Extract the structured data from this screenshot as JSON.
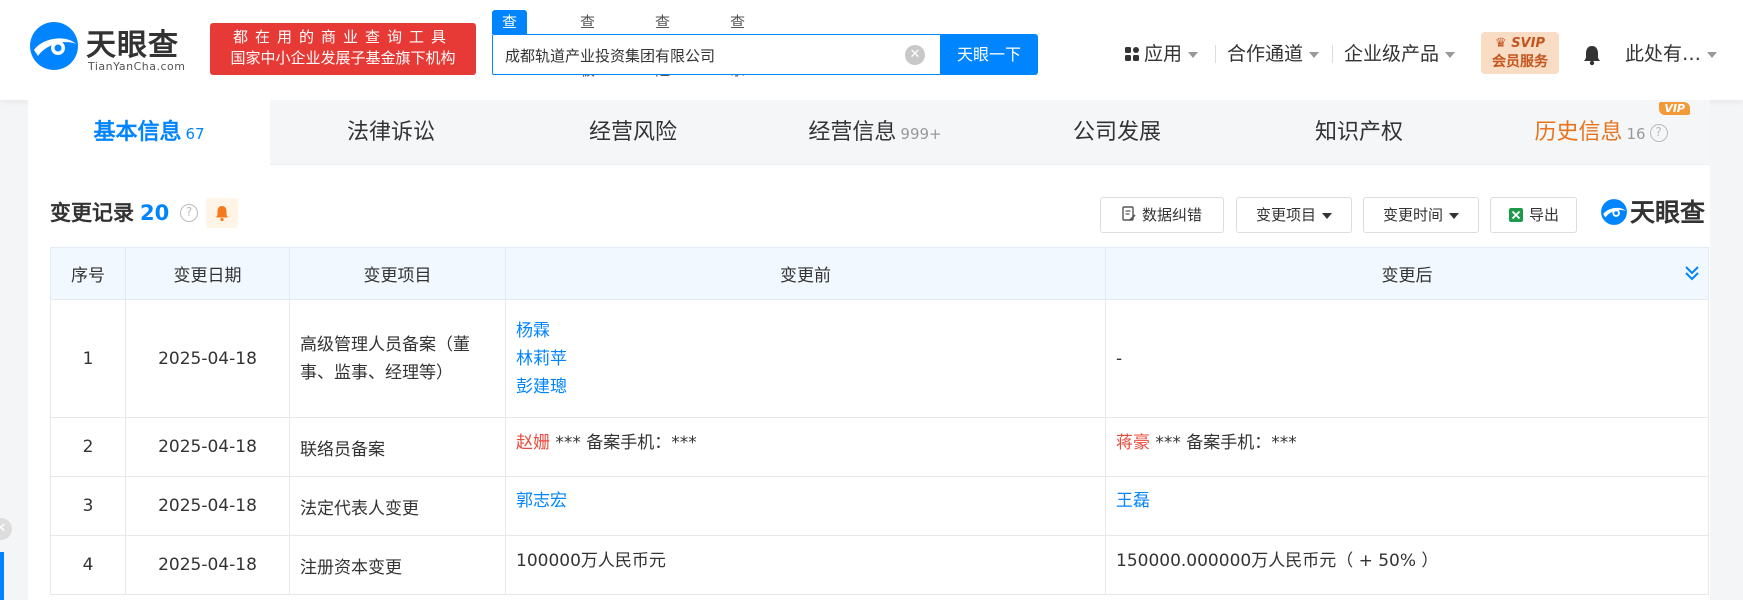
{
  "header": {
    "logo_text": "天眼查",
    "logo_sub": "TianYanCha.com",
    "slogan_line1": "都在用的商业查询工具",
    "slogan_line2": "国家中小企业发展子基金旗下机构",
    "search_tabs": [
      "查公司",
      "查老板",
      "查风险",
      "查关系"
    ],
    "search_value": "成都轨道产业投资集团有限公司",
    "search_button": "天眼一下",
    "nav": [
      "应用",
      "合作通道",
      "企业级产品"
    ],
    "svip_line1": "SVIP",
    "svip_line2": "会员服务",
    "user": "此处有…"
  },
  "tabs": [
    {
      "label": "基本信息",
      "count": "67"
    },
    {
      "label": "法律诉讼",
      "count": ""
    },
    {
      "label": "经营风险",
      "count": ""
    },
    {
      "label": "经营信息",
      "count": "999+"
    },
    {
      "label": "公司发展",
      "count": ""
    },
    {
      "label": "知识产权",
      "count": ""
    },
    {
      "label": "历史信息",
      "count": "16"
    }
  ],
  "vip_tag": "VIP",
  "section": {
    "title": "变更记录",
    "count": "20",
    "buttons": {
      "correct": "数据纠错",
      "change_item": "变更项目",
      "change_time": "变更时间",
      "export": "导出"
    },
    "brand": "天眼查"
  },
  "table": {
    "headers": [
      "序号",
      "变更日期",
      "变更项目",
      "变更前",
      "变更后"
    ],
    "rows": [
      {
        "no": "1",
        "date": "2025-04-18",
        "item": "高级管理人员备案（董事、监事、经理等）",
        "before_names": [
          "杨霖",
          "林莉苹",
          "彭建璁"
        ],
        "after": "-"
      },
      {
        "no": "2",
        "date": "2025-04-18",
        "item": "联络员备案",
        "before_name": "赵姗",
        "before_rest": " *** 备案手机：***",
        "after_name": "蒋豪",
        "after_rest": " *** 备案手机：***"
      },
      {
        "no": "3",
        "date": "2025-04-18",
        "item": "法定代表人变更",
        "before_name": "郭志宏",
        "after_name": "王磊"
      },
      {
        "no": "4",
        "date": "2025-04-18",
        "item": "注册资本变更",
        "before": "100000万人民币元",
        "after": "150000.000000万人民币元（ + 50% ）"
      }
    ]
  },
  "colors": {
    "accent": "#0084ff",
    "danger": "#e84b3c",
    "history": "#e8731c",
    "slogan_bg": "#e73935"
  }
}
